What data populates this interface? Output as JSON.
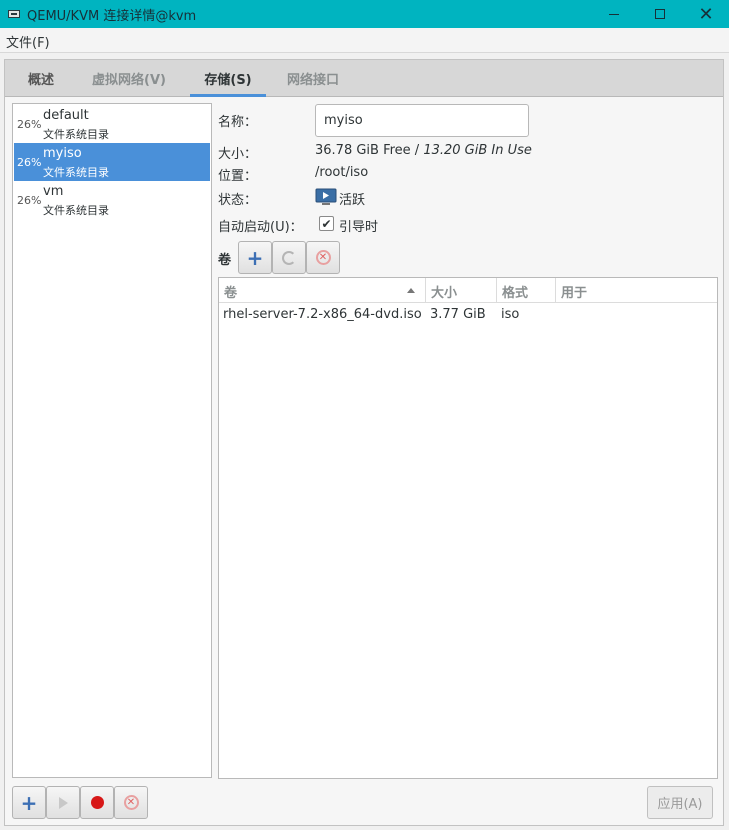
{
  "window": {
    "title": "QEMU/KVM 连接详情@kvm",
    "minimize_icon": "minimize-icon",
    "maximize_icon": "maximize-icon",
    "close_icon": "close-icon"
  },
  "menubar": {
    "file": "文件(F)"
  },
  "tabs": [
    {
      "label": "概述"
    },
    {
      "label": "虚拟网络(V)"
    },
    {
      "label": "存储(S)",
      "selected": true
    },
    {
      "label": "网络接口"
    }
  ],
  "pools": [
    {
      "percent": "26%",
      "name": "default",
      "type": "文件系统目录"
    },
    {
      "percent": "26%",
      "name": "myiso",
      "type": "文件系统目录",
      "selected": true
    },
    {
      "percent": "26%",
      "name": "vm",
      "type": "文件系统目录"
    }
  ],
  "details": {
    "name_label": "名称：",
    "name_value": "myiso",
    "size_label": "大小：",
    "size_free": "36.78 GiB Free",
    "size_sep": " / ",
    "size_in_use": "13.20 GiB In Use",
    "location_label": "位置：",
    "location_value": "/root/iso",
    "state_label": "状态：",
    "state_value": "活跃",
    "autostart_label": "自动启动(U)：",
    "autostart_value": "引导时",
    "autostart_checked": true
  },
  "volumes": {
    "label": "卷",
    "columns": [
      "卷",
      "大小",
      "格式",
      "用于"
    ],
    "rows": [
      {
        "name": "rhel-server-7.2-x86_64-dvd.iso",
        "size": "3.77 GiB",
        "format": "iso",
        "used_by": ""
      }
    ]
  },
  "buttons": {
    "apply": "应用(A)"
  },
  "colors": {
    "titlebar": "#00b4c0",
    "selection": "#4a90d9",
    "stop_red": "#d71818"
  }
}
